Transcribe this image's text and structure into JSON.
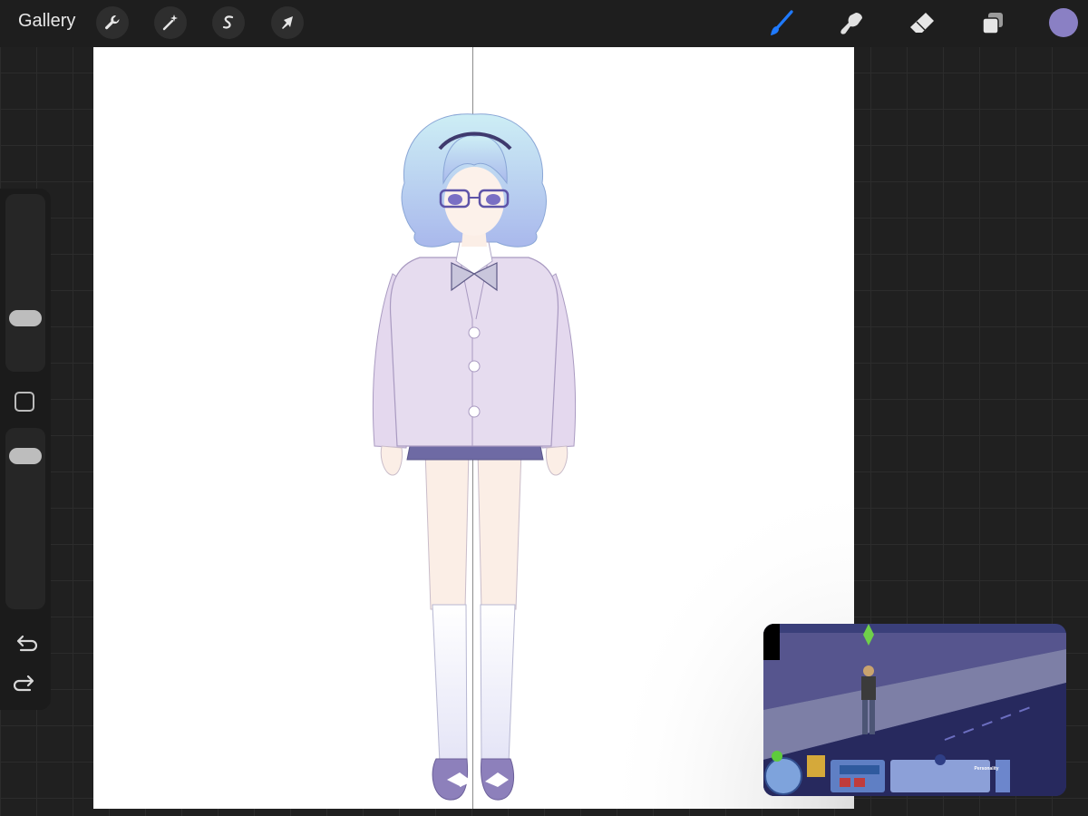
{
  "toolbar": {
    "gallery_label": "Gallery",
    "left_tools": [
      "wrench-icon",
      "magic-wand-icon",
      "selection-icon",
      "transform-arrow-icon"
    ],
    "right_tools": [
      "brush-icon",
      "smudge-icon",
      "eraser-icon",
      "layers-icon"
    ],
    "active_tool": "brush-icon",
    "current_color": "#8a80c4",
    "accent": "#1f7aff"
  },
  "sidebar": {
    "brush_size_level": 0.72,
    "opacity_level": 0.88
  },
  "pip": {
    "panel_title": "Personality"
  }
}
